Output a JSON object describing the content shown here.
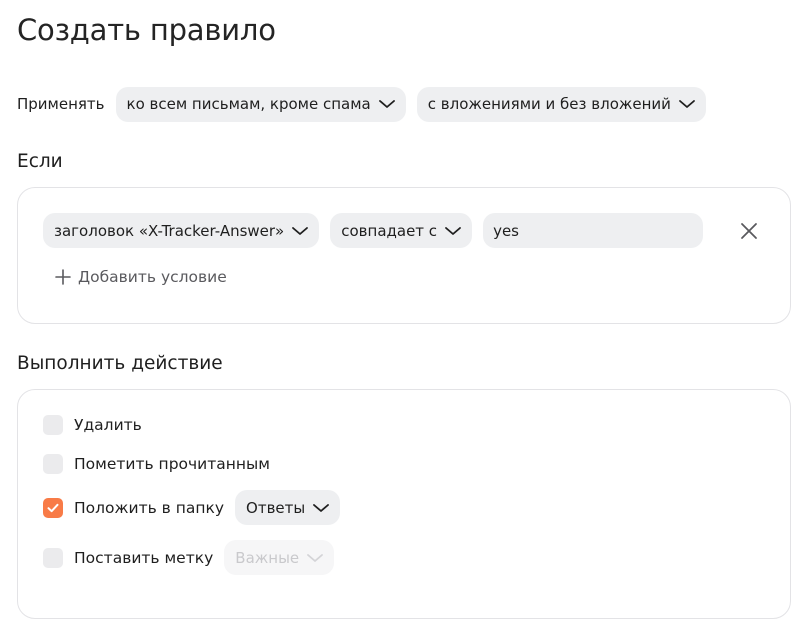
{
  "page": {
    "title": "Создать правило"
  },
  "apply": {
    "label": "Применять",
    "scope_select": "ко всем письмам, кроме спама",
    "attachments_select": "с вложениями и без вложений"
  },
  "conditions": {
    "section_title": "Если",
    "items": [
      {
        "field_select": "заголовок «X-Tracker-Answer»",
        "operator_select": "совпадает с",
        "value": "yes"
      }
    ],
    "add_label": "Добавить условие"
  },
  "actions": {
    "section_title": "Выполнить действие",
    "items": [
      {
        "label": "Удалить",
        "checked": false
      },
      {
        "label": "Пометить прочитанным",
        "checked": false
      },
      {
        "label": "Положить в папку",
        "checked": true,
        "select": "Ответы"
      },
      {
        "label": "Поставить метку",
        "checked": false,
        "select": "Важные",
        "select_disabled": true
      }
    ]
  },
  "colors": {
    "accent_checkbox": "#f87b47",
    "pill_background": "#eeeff1",
    "card_border": "#e3e3e6"
  },
  "icons": {
    "dropdown": "chevron-down-icon",
    "remove_condition": "close-icon",
    "add_condition": "plus-icon",
    "checked": "checkmark-icon"
  }
}
